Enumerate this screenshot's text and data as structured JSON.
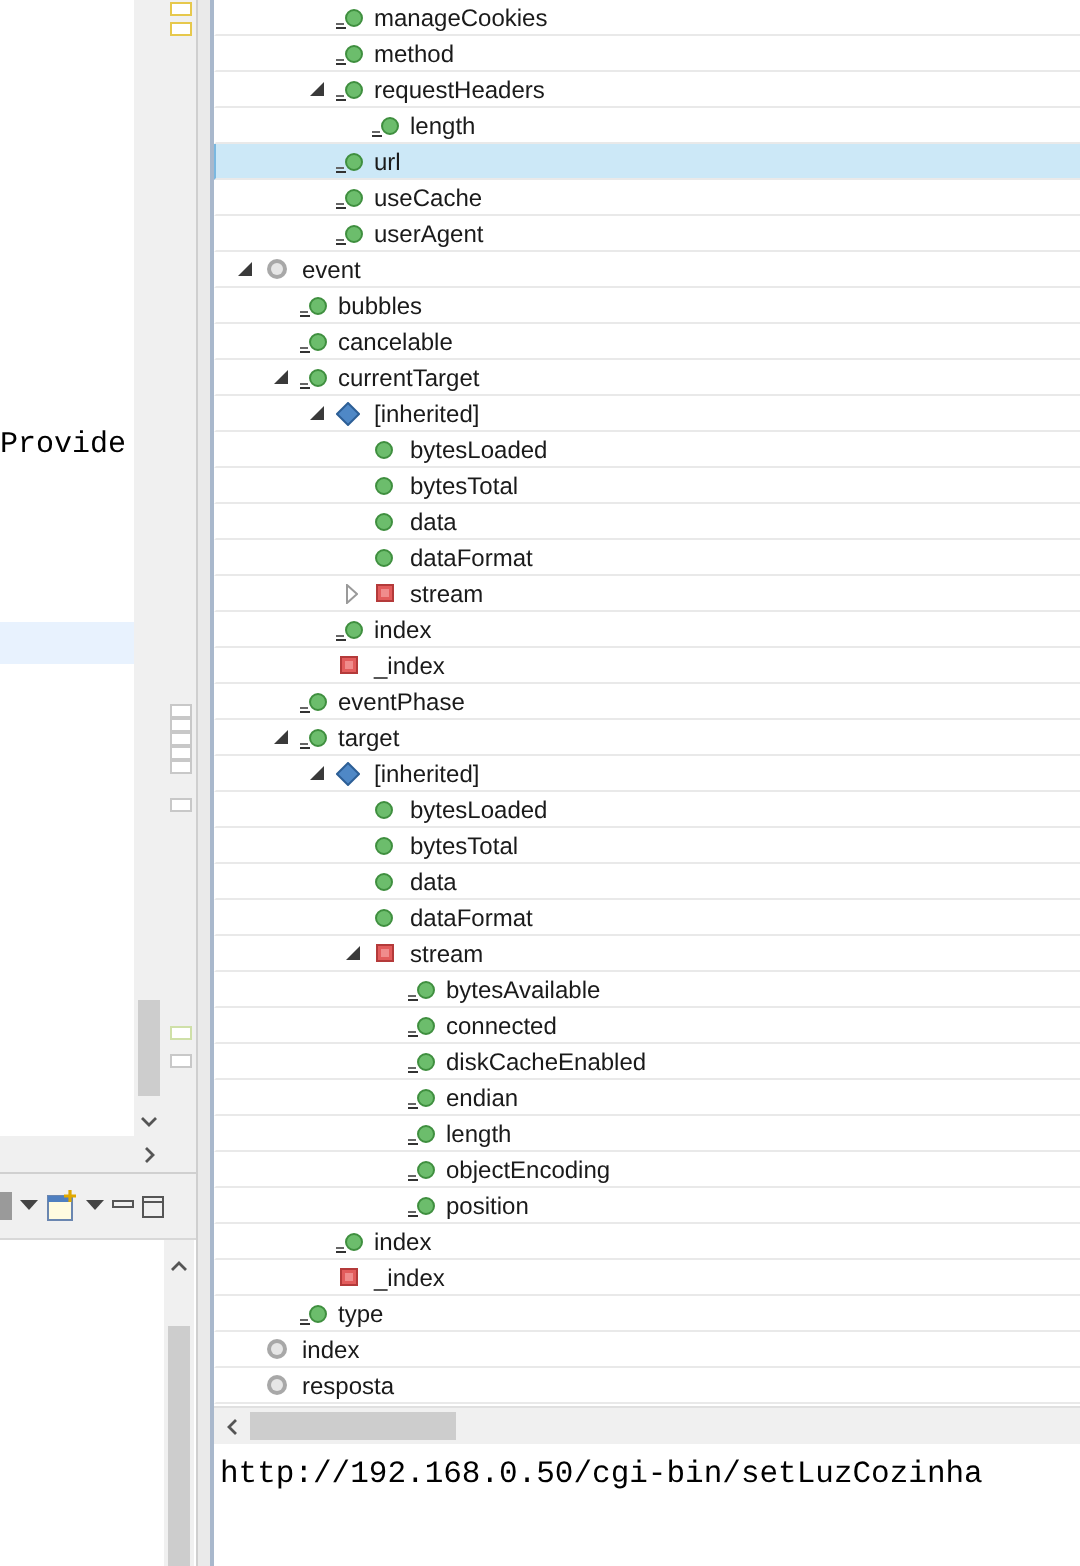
{
  "editor": {
    "text": "Provide"
  },
  "tree": [
    {
      "children": [
        {
          "children": [
            {
              "label": "manageCookies",
              "kind": "property"
            },
            {
              "label": "method",
              "kind": "property"
            },
            {
              "label": "requestHeaders",
              "kind": "property",
              "expanded": true,
              "children": [
                {
                  "label": "length",
                  "kind": "property"
                }
              ]
            },
            {
              "label": "url",
              "kind": "property",
              "selected": true
            },
            {
              "label": "useCache",
              "kind": "property"
            },
            {
              "label": "userAgent",
              "kind": "property"
            }
          ]
        }
      ]
    },
    {
      "label": "event",
      "kind": "local",
      "expanded": true,
      "children": [
        {
          "label": "bubbles",
          "kind": "property"
        },
        {
          "label": "cancelable",
          "kind": "property"
        },
        {
          "label": "currentTarget",
          "kind": "property",
          "expanded": true,
          "children": [
            {
              "label": "[inherited]",
              "kind": "inherited",
              "expanded": true,
              "children": [
                {
                  "label": "bytesLoaded",
                  "kind": "field"
                },
                {
                  "label": "bytesTotal",
                  "kind": "field"
                },
                {
                  "label": "data",
                  "kind": "field"
                },
                {
                  "label": "dataFormat",
                  "kind": "field"
                },
                {
                  "label": "stream",
                  "kind": "private",
                  "expanded": false
                }
              ]
            },
            {
              "label": "index",
              "kind": "property"
            },
            {
              "label": "_index",
              "kind": "private"
            }
          ]
        },
        {
          "label": "eventPhase",
          "kind": "property"
        },
        {
          "label": "target",
          "kind": "property",
          "expanded": true,
          "children": [
            {
              "label": "[inherited]",
              "kind": "inherited",
              "expanded": true,
              "children": [
                {
                  "label": "bytesLoaded",
                  "kind": "field"
                },
                {
                  "label": "bytesTotal",
                  "kind": "field"
                },
                {
                  "label": "data",
                  "kind": "field"
                },
                {
                  "label": "dataFormat",
                  "kind": "field"
                },
                {
                  "label": "stream",
                  "kind": "private",
                  "expanded": true,
                  "children": [
                    {
                      "label": "bytesAvailable",
                      "kind": "property"
                    },
                    {
                      "label": "connected",
                      "kind": "property"
                    },
                    {
                      "label": "diskCacheEnabled",
                      "kind": "property"
                    },
                    {
                      "label": "endian",
                      "kind": "property"
                    },
                    {
                      "label": "length",
                      "kind": "property"
                    },
                    {
                      "label": "objectEncoding",
                      "kind": "property"
                    },
                    {
                      "label": "position",
                      "kind": "property"
                    }
                  ]
                }
              ]
            },
            {
              "label": "index",
              "kind": "property"
            },
            {
              "label": "_index",
              "kind": "private"
            }
          ]
        },
        {
          "label": "type",
          "kind": "property"
        }
      ]
    },
    {
      "label": "index",
      "kind": "local"
    },
    {
      "label": "resposta",
      "kind": "local"
    }
  ],
  "detail": {
    "value": "http://192.168.0.50/cgi-bin/setLuzCozinha"
  }
}
